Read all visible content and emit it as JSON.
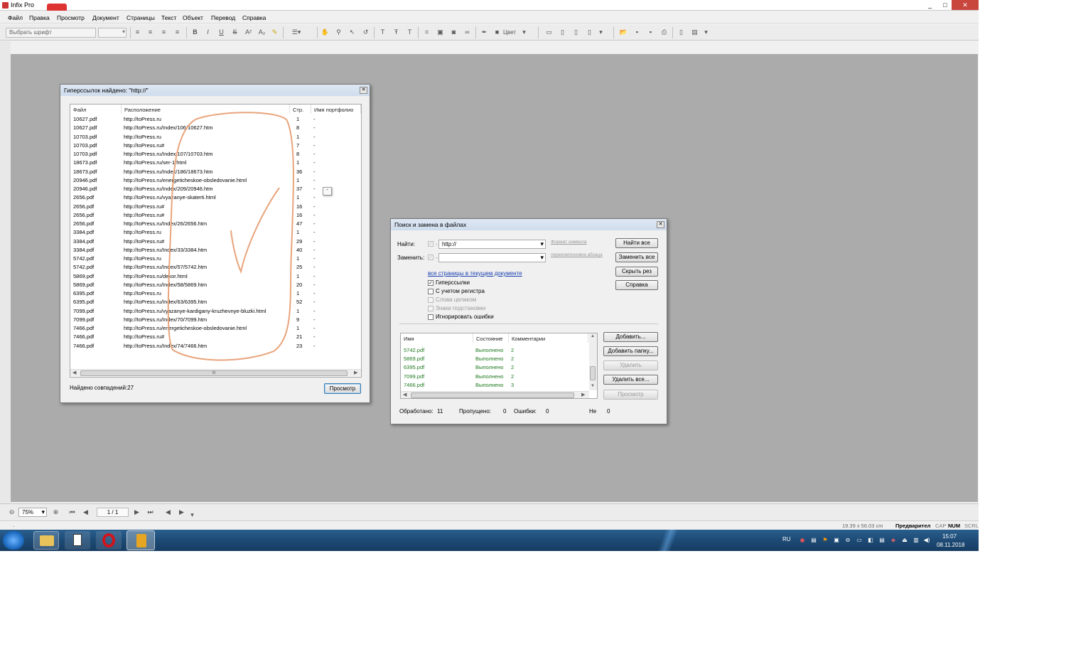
{
  "app": {
    "title": "Infix Pro",
    "window_controls": [
      "_",
      "□",
      "✕"
    ]
  },
  "menu": [
    "Файл",
    "Правка",
    "Просмотр",
    "Документ",
    "Страницы",
    "Текст",
    "Объект",
    "Перевод",
    "Справка"
  ],
  "toolbar": {
    "font_placeholder": "Выбрать шрифт",
    "color_label": "Цвет"
  },
  "dialog_links": {
    "title": "Гиперссылок найдено: \"http://\"",
    "columns": [
      "Файл",
      "Расположение",
      "Стр.",
      "Имя портфолио"
    ],
    "rows": [
      [
        "10627.pdf",
        "http://toPress.ru",
        "1",
        "-"
      ],
      [
        "10627.pdf",
        "http://toPress.ru/Index/106/10627.htm",
        "8",
        "-"
      ],
      [
        "10703.pdf",
        "http://toPress.ru",
        "1",
        "-"
      ],
      [
        "10703.pdf",
        "http://toPress.ru#",
        "7",
        "-"
      ],
      [
        "10703.pdf",
        "http://toPress.ru/Index/107/10703.htm",
        "8",
        "-"
      ],
      [
        "18673.pdf",
        "http://toPress.ru/ser-1.html",
        "1",
        "-"
      ],
      [
        "18673.pdf",
        "http://toPress.ru/Index/186/18673.htm",
        "36",
        "-"
      ],
      [
        "20946.pdf",
        "http://toPress.ru/energeticheskoe-obsledovanie.html",
        "1",
        "-"
      ],
      [
        "20946.pdf",
        "http://toPress.ru/Index/209/20946.htm",
        "37",
        "-"
      ],
      [
        "2656.pdf",
        "http://toPress.ru/vyazanye-skaterti.html",
        "1",
        "-"
      ],
      [
        "2656.pdf",
        "http://toPress.ru#",
        "16",
        "-"
      ],
      [
        "2656.pdf",
        "http://toPress.ru#",
        "16",
        "-"
      ],
      [
        "2656.pdf",
        "http://toPress.ru/Index/26/2656.htm",
        "47",
        "-"
      ],
      [
        "3384.pdf",
        "http://toPress.ru",
        "1",
        "-"
      ],
      [
        "3384.pdf",
        "http://toPress.ru#",
        "29",
        "-"
      ],
      [
        "3384.pdf",
        "http://toPress.ru/Index/33/3384.htm",
        "40",
        "-"
      ],
      [
        "5742.pdf",
        "http://toPress.ru",
        "1",
        "-"
      ],
      [
        "5742.pdf",
        "http://toPress.ru/Index/57/5742.htm",
        "25",
        "-"
      ],
      [
        "5869.pdf",
        "http://toPress.ru/dekor.html",
        "1",
        "-"
      ],
      [
        "5869.pdf",
        "http://toPress.ru/Index/58/5869.htm",
        "20",
        "-"
      ],
      [
        "6395.pdf",
        "http://toPress.ru",
        "1",
        "-"
      ],
      [
        "6395.pdf",
        "http://toPress.ru/Index/63/6395.htm",
        "52",
        "-"
      ],
      [
        "7099.pdf",
        "http://toPress.ru/vyazanye-kardigany-kruzhevnye-bluzki.html",
        "1",
        "-"
      ],
      [
        "7099.pdf",
        "http://toPress.ru/Index/70/7099.htm",
        "9",
        "-"
      ],
      [
        "7466.pdf",
        "http://toPress.ru/energeticheskoe-obsledovanie.html",
        "1",
        "-"
      ],
      [
        "7466.pdf",
        "http://toPress.ru#",
        "21",
        "-"
      ],
      [
        "7466.pdf",
        "http://toPress.ru/Index/74/7466.htm",
        "23",
        "-"
      ]
    ],
    "scroll_grip": "III",
    "tooltip": "-",
    "found_label": "Найдено совпадений:27",
    "view_button": "Просмотр"
  },
  "dialog_search": {
    "title": "Поиск и замена в файлах",
    "find_label": "Найти:",
    "find_value": "http://",
    "replace_label": "Заменить:",
    "replace_value": "",
    "dash": "-",
    "format_link": "Формат символа",
    "reflow_link": "перекомпоновка абзаца",
    "scope_link": "все страницы в текущем документе",
    "options": [
      {
        "label": "Гиперссылки",
        "checked": true,
        "enabled": true
      },
      {
        "label": "С учетом регистра",
        "checked": false,
        "enabled": true
      },
      {
        "label": "Слова целиком",
        "checked": false,
        "enabled": false
      },
      {
        "label": "Знаки подстановки",
        "checked": false,
        "enabled": false
      },
      {
        "label": "Игнорировать ошибки",
        "checked": false,
        "enabled": true
      }
    ],
    "buttons": [
      "Найти все",
      "Заменить все",
      "Скрыть рез",
      "Справка"
    ],
    "file_columns": [
      "Имя",
      "Состояние",
      "Комментарии"
    ],
    "files": [
      [
        "5742.pdf",
        "Выполнено",
        "2"
      ],
      [
        "5869.pdf",
        "Выполнено",
        "2"
      ],
      [
        "6395.pdf",
        "Выполнено",
        "2"
      ],
      [
        "7099.pdf",
        "Выполнено",
        "2"
      ],
      [
        "7466.pdf",
        "Выполнено",
        "3"
      ]
    ],
    "file_buttons": [
      "Добавить...",
      "Добавить папку...",
      "Удалить",
      "Удалить все...",
      "Просмотр"
    ],
    "stats": {
      "processed_label": "Обработано:",
      "processed": "11",
      "skipped_label": "Пропущено:",
      "skipped": "0",
      "errors_label": "Ошибки:",
      "errors": "0",
      "not_label": "Не",
      "not": "0"
    },
    "success_color": "#1f7a1f"
  },
  "nav": {
    "zoom": "75%",
    "page": "1 / 1",
    "dot": "."
  },
  "status": {
    "size": "19.39 x 56.03 cm",
    "mode": "Предварител",
    "caps": "CAP",
    "num": "NUM",
    "scrl": "SCRL"
  },
  "taskbar": {
    "lang": "RU",
    "time": "15:07",
    "date": "08.11.2018"
  }
}
